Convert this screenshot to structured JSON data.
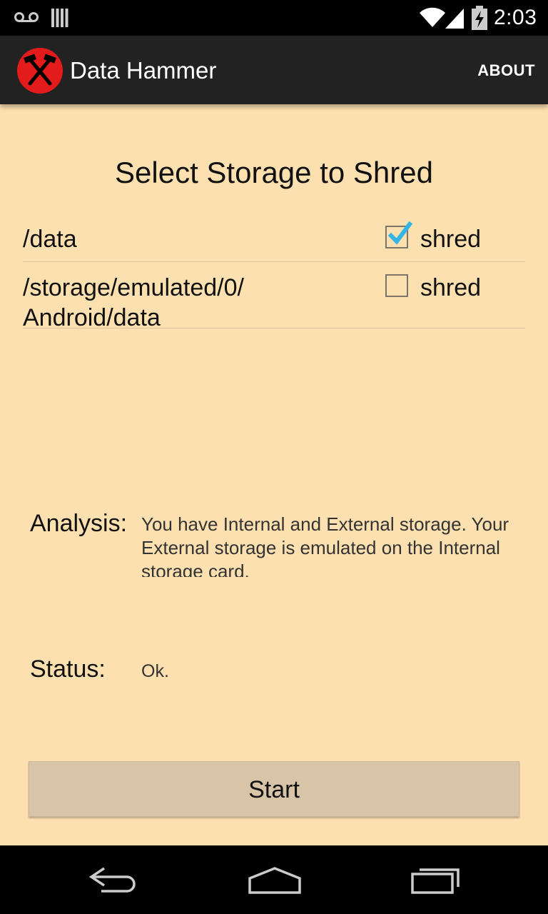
{
  "status_bar": {
    "time": "2:03",
    "icons": [
      "voicemail-icon",
      "sim-icon",
      "wifi-icon",
      "signal-icon",
      "battery-charging-icon"
    ]
  },
  "action_bar": {
    "title": "Data Hammer",
    "about_label": "ABOUT",
    "logo": "hammers-logo-icon"
  },
  "main": {
    "heading": "Select Storage to Shred",
    "storage_list": [
      {
        "path": "/data",
        "checked": true,
        "label": "shred"
      },
      {
        "path": "/storage/emulated/0/\nAndroid/data",
        "checked": false,
        "label": "shred"
      }
    ],
    "analysis": {
      "label": "Analysis:",
      "text": "You have Internal and External storage. Your External storage is emulated on the Internal storage card."
    },
    "status": {
      "label": "Status:",
      "value": "Ok."
    },
    "start_label": "Start"
  },
  "colors": {
    "background": "#fde0b0",
    "action_bar": "#222222",
    "button": "#d8c5a8",
    "checkmark": "#33b5e5",
    "logo_red": "#e31b1b"
  },
  "nav_bar": {
    "buttons": [
      "back-icon",
      "home-icon",
      "recents-icon"
    ]
  }
}
